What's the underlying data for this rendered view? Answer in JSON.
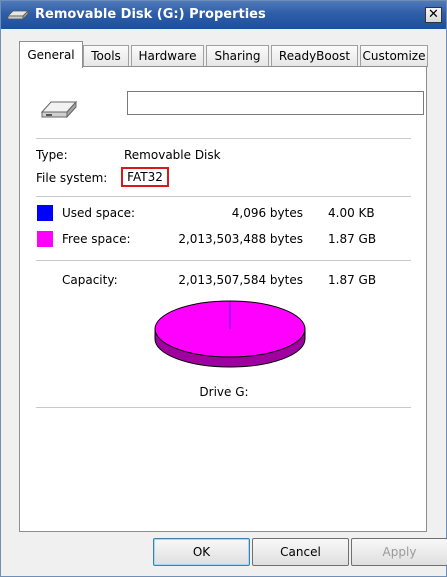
{
  "window": {
    "title": "Removable Disk (G:) Properties",
    "close_symbol": "✕"
  },
  "tabs": [
    {
      "label": "General",
      "active": true
    },
    {
      "label": "Tools",
      "active": false
    },
    {
      "label": "Hardware",
      "active": false
    },
    {
      "label": "Sharing",
      "active": false
    },
    {
      "label": "ReadyBoost",
      "active": false
    },
    {
      "label": "Customize",
      "active": false
    }
  ],
  "general": {
    "name_value": "",
    "type_label": "Type:",
    "type_value": "Removable Disk",
    "fs_label": "File system:",
    "fs_value": "FAT32",
    "used_label": "Used space:",
    "used_bytes": "4,096 bytes",
    "used_size": "4.00 KB",
    "free_label": "Free space:",
    "free_bytes": "2,013,503,488 bytes",
    "free_size": "1.87 GB",
    "capacity_label": "Capacity:",
    "capacity_bytes": "2,013,507,584 bytes",
    "capacity_size": "1.87 GB",
    "drive_label": "Drive G:"
  },
  "colors": {
    "used": "#0000ff",
    "free": "#ff00ff",
    "free_shadow": "#a000a0",
    "highlight": "#d8191a"
  },
  "usage": {
    "used_fraction": 2e-06,
    "free_fraction": 0.999998
  },
  "buttons": {
    "ok": "OK",
    "cancel": "Cancel",
    "apply": "Apply"
  }
}
